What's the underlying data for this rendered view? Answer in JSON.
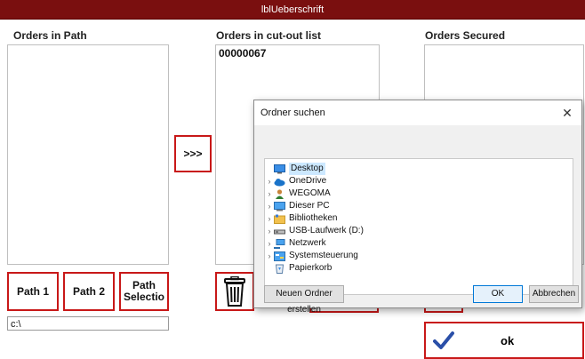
{
  "window": {
    "title": "lblUeberschrift"
  },
  "columns": {
    "path": {
      "header": "Orders in Path"
    },
    "cutout": {
      "header": "Orders in cut-out list",
      "items": [
        "00000067"
      ]
    },
    "secured": {
      "header": "Orders Secured"
    }
  },
  "buttons": {
    "move_right": ">>>",
    "path1": "Path 1",
    "path2": "Path 2",
    "path_selection": "Path\nSelectio",
    "ok": "ok"
  },
  "path_field": {
    "value": "c:\\"
  },
  "dialog": {
    "title": "Ordner suchen",
    "tree": [
      {
        "label": "Desktop",
        "icon": "desktop-icon",
        "selected": true,
        "expander": false
      },
      {
        "label": "OneDrive",
        "icon": "cloud-icon",
        "expander": true
      },
      {
        "label": "WEGOMA",
        "icon": "user-icon",
        "expander": true
      },
      {
        "label": "Dieser PC",
        "icon": "computer-icon",
        "expander": true
      },
      {
        "label": "Bibliotheken",
        "icon": "library-icon",
        "expander": true
      },
      {
        "label": "USB-Laufwerk (D:)",
        "icon": "usb-drive-icon",
        "expander": true
      },
      {
        "label": "Netzwerk",
        "icon": "network-icon",
        "expander": true
      },
      {
        "label": "Systemsteuerung",
        "icon": "control-panel-icon",
        "expander": true
      },
      {
        "label": "Papierkorb",
        "icon": "recycle-bin-icon",
        "expander": false
      }
    ],
    "new_folder": "Neuen Ordner erstellen",
    "ok": "OK",
    "cancel": "Abbrechen"
  },
  "colors": {
    "titlebar": "#7a0f0f",
    "accent_red": "#c81818",
    "selection": "#cce8ff"
  }
}
